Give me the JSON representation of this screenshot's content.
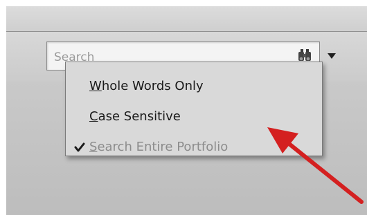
{
  "search": {
    "placeholder": "Search",
    "button_icon": "binoculars-icon",
    "dropdown_icon": "dropdown-arrow-icon"
  },
  "menu": {
    "items": [
      {
        "prefix": "",
        "underlined": "W",
        "rest": "hole Words Only",
        "checked": false,
        "enabled": true
      },
      {
        "prefix": "",
        "underlined": "C",
        "rest": "ase Sensitive",
        "checked": false,
        "enabled": true
      },
      {
        "prefix": "",
        "underlined": "S",
        "rest": "earch Entire Portfolio",
        "checked": true,
        "enabled": false
      }
    ]
  },
  "colors": {
    "annotation_arrow": "#d42020",
    "menu_background": "#d9d9d9",
    "disabled_text": "#8c8c8c"
  }
}
